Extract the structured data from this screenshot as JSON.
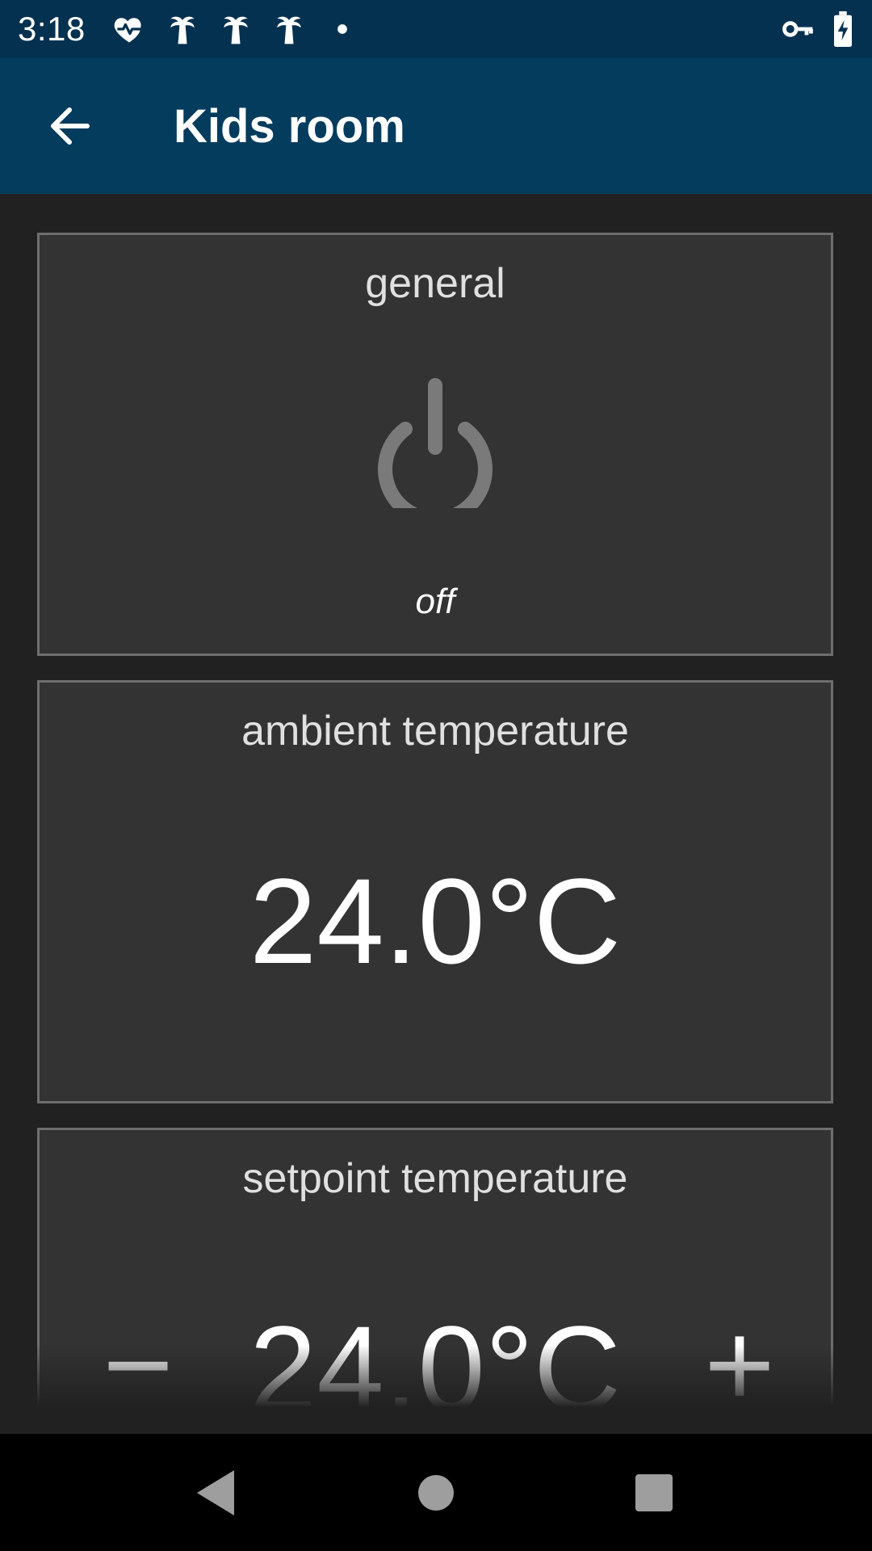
{
  "status_bar": {
    "time": "3:18",
    "icons": [
      "heart-pulse-icon",
      "palm-tree-icon",
      "palm-tree-icon",
      "palm-tree-icon",
      "dot-icon",
      "vpn-key-icon",
      "battery-charging-icon"
    ]
  },
  "app_bar": {
    "title": "Kids room",
    "back_icon": "arrow-left-icon"
  },
  "cards": {
    "general": {
      "title": "general",
      "icon": "power-icon",
      "state": "off"
    },
    "ambient": {
      "title": "ambient temperature",
      "value": "24.0°C"
    },
    "setpoint": {
      "title": "setpoint temperature",
      "value": "24.0°C",
      "decrease_label": "−",
      "increase_label": "+"
    }
  },
  "nav_bar": {
    "icons": [
      "back-triangle-icon",
      "home-circle-icon",
      "recents-square-icon"
    ]
  },
  "colors": {
    "status_bar": "#04314f",
    "app_bar": "#043c5e",
    "background": "#212121",
    "card": "#333333",
    "card_border": "#6e6e6e",
    "power_icon": "#7a7a7a"
  }
}
